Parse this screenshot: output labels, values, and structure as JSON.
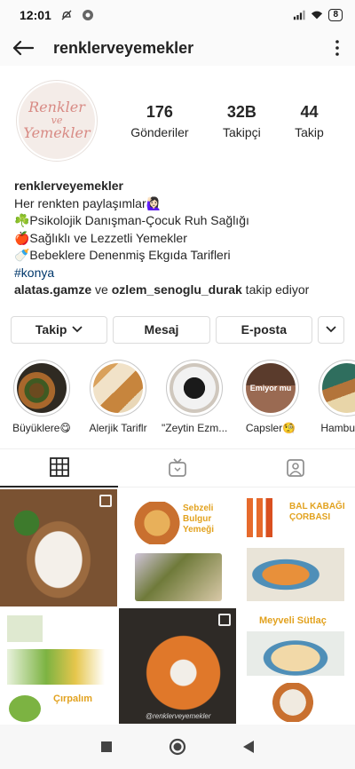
{
  "status": {
    "time": "12:01",
    "battery": "8"
  },
  "nav": {
    "title": "renklerveyemekler"
  },
  "avatar": {
    "line1": "Renkler",
    "line2": "ve",
    "line3": "Yemekler"
  },
  "stats": [
    {
      "value": "176",
      "label": "Gönderiler"
    },
    {
      "value": "32B",
      "label": "Takipçi"
    },
    {
      "value": "44",
      "label": "Takip"
    }
  ],
  "bio": {
    "name": "renklerveyemekler",
    "lines": [
      "Her renkten paylaşımlar🙋🏻‍♀️",
      "☘️Psikolojik Danışman-Çocuk Ruh Sağlığı",
      "🍎Sağlıklı ve Lezzetli Yemekler",
      "🍼Bebeklere  Denenmiş Ekgıda Tarifleri"
    ],
    "hashtag": "#konya",
    "followed_user1": "alatas.gamze",
    "followed_joiner": " ve ",
    "followed_user2": "ozlem_senoglu_durak",
    "followed_suffix": " takip ediyor"
  },
  "actions": {
    "follow": "Takip",
    "message": "Mesaj",
    "email": "E-posta"
  },
  "highlights": [
    {
      "label": "Büyüklere😋"
    },
    {
      "label": "Alerjik Tariflr"
    },
    {
      "label": "\"Zeytin Ezm..."
    },
    {
      "label": "Capsler🧐"
    },
    {
      "label": "Hamburg..."
    }
  ],
  "highlight_overlay": "Emiyor mu",
  "grid_texts": {
    "sebzeli": "Sebzeli Bulgur Yemeği",
    "bal": "BAL KABAĞI ÇORBASI",
    "meyveli": "Meyveli Sütlaç",
    "cirpalim": "Çırpalım",
    "watermark": "@renklerveyemekler"
  },
  "colors": {
    "link": "#00376b",
    "border": "#dbdbdb",
    "text": "#262626"
  }
}
